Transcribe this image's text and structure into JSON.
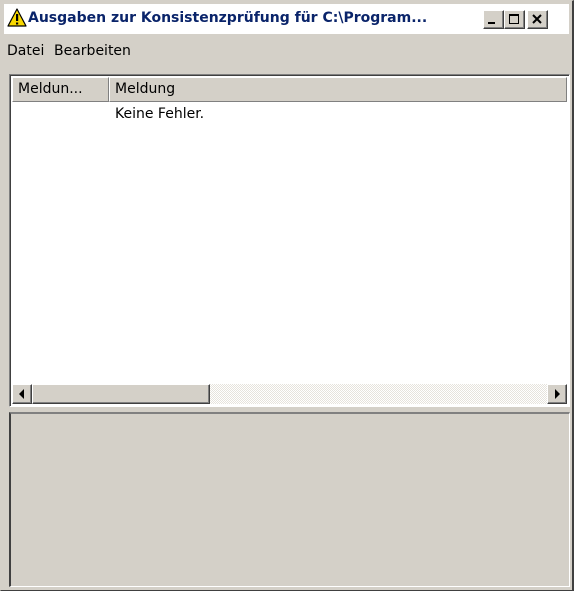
{
  "window": {
    "title": "Ausgaben zur Konsistenzprüfung für  C:\\Program...",
    "icon": "warning-icon",
    "controls": [
      "minimize-icon",
      "maximize-icon",
      "close-icon"
    ]
  },
  "menu": {
    "items": [
      "Datei",
      "Bearbeiten"
    ]
  },
  "list": {
    "columns": [
      "Meldun...",
      "Meldung"
    ],
    "rows": [
      {
        "type": "",
        "message": "Keine Fehler."
      }
    ]
  },
  "colors": {
    "title_text": "#0a246a",
    "face": "#d4d0c8",
    "warning_yellow": "#f8d800"
  }
}
